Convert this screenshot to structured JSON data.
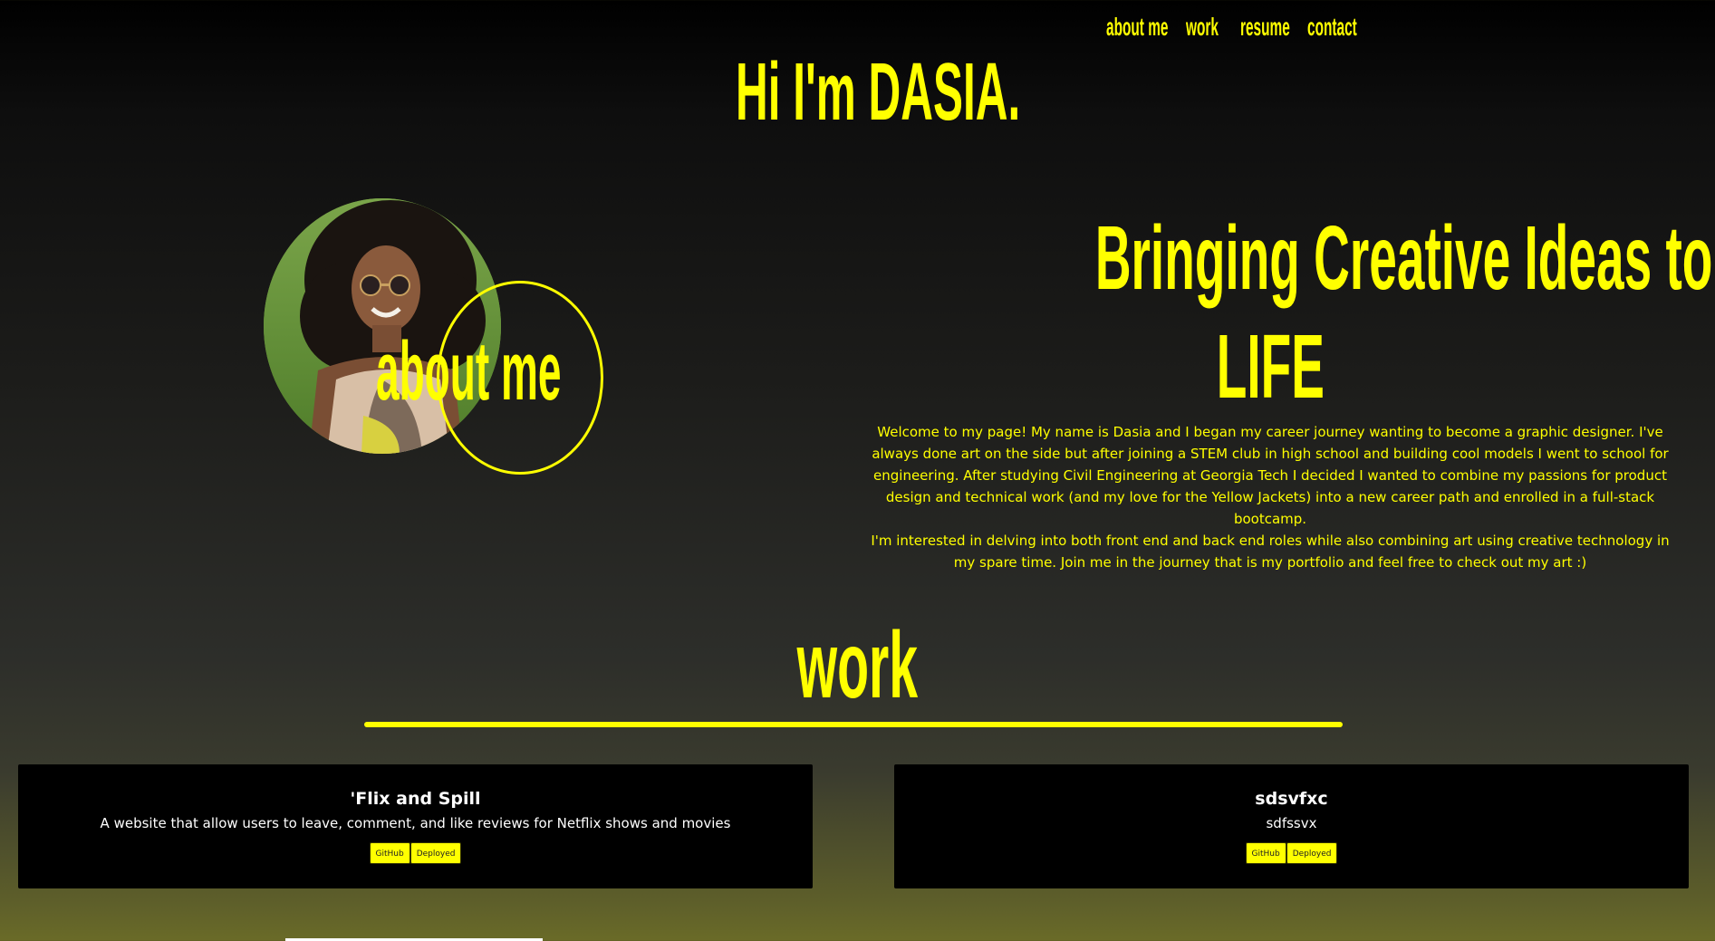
{
  "nav": {
    "items": [
      {
        "label": "about me"
      },
      {
        "label": "work"
      },
      {
        "label": "resume"
      },
      {
        "label": "contact"
      }
    ]
  },
  "hero": {
    "title": "Hi I'm DASIA."
  },
  "about": {
    "heading": "about me",
    "tagline_line1": "Bringing Creative Ideas to",
    "tagline_line2": "LIFE",
    "bio_paragraph1": "Welcome to my page! My name is Dasia and I began my career journey wanting to become a graphic designer. I've always done art on the side but after joining a STEM club in high school and building cool models I went to school for engineering. After studying Civil Engineering at Georgia Tech I decided I wanted to combine my passions for product design and technical work (and my love for the Yellow Jackets) into a new career path and enrolled in a full-stack bootcamp.",
    "bio_paragraph2": "I'm interested in delving into both front end and back end roles while also combining art using creative technology in my spare time. Join me in the journey that is my portfolio and feel free to check out my art :)"
  },
  "work": {
    "heading": "work",
    "projects": [
      {
        "title": "'Flix and Spill",
        "description": "A website that allow users to leave, comment, and like reviews for Netflix shows and movies",
        "github_label": "GitHub",
        "deployed_label": "Deployed"
      },
      {
        "title": "sdsvfxc",
        "description": "sdfssvx",
        "github_label": "GitHub",
        "deployed_label": "Deployed"
      }
    ]
  },
  "colors": {
    "accent": "#ffff00",
    "card_background": "#000000",
    "card_text": "#ffffff"
  },
  "icons": {
    "avatar": "profile-photo"
  }
}
